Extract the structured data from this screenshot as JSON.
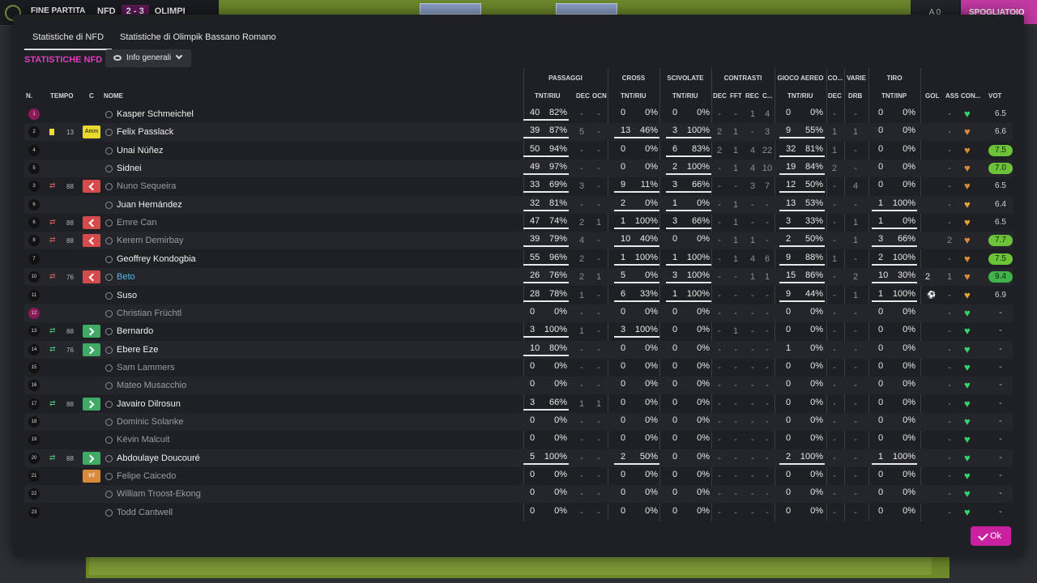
{
  "topbar": {
    "end_match": "FINE PARTITA",
    "home": "NFD",
    "score": "2 - 3",
    "away": "OLIMPI",
    "score_mini": "A 0",
    "locker_button": "SPOGLIATOIO"
  },
  "tabs": [
    {
      "label": "Statistiche di NFD",
      "active": true
    },
    {
      "label": "Statistiche di Olimpik Bassano Romano",
      "active": false
    }
  ],
  "section_title": "STATISTICHE NFD",
  "view_dropdown": {
    "label": "Info generali",
    "icon": "eye-icon"
  },
  "groups": {
    "passaggi": "PASSAGGI",
    "cross": "CROSS",
    "scivolate": "SCIVOLATE",
    "contrasti": "CONTRASTI",
    "gioco_aereo": "GIOCO AEREO",
    "co": "CO...",
    "varie": "VARIE",
    "tiro": "TIRO"
  },
  "columns": {
    "n": "N.",
    "tempo": "TEMPO",
    "c": "C",
    "nome": "NOME",
    "pass_tntriu": "TNT/RIU",
    "pass_dec": "DEC",
    "pass_ocn": "OCN",
    "cross_tntriu": "TNT/RIU",
    "sciv_tntriu": "TNT/RIU",
    "contr_dec": "DEC",
    "contr_fft": "FFT",
    "contr_rec": "REC",
    "contr_c": "C...",
    "aereo_tntriu": "TNT/RIU",
    "co_dec": "DEC",
    "varie_drb": "DRB",
    "tiro_tntinp": "TNT/INP",
    "gol": "GOL",
    "ass": "ASS",
    "con": "CON...",
    "vot": "VOT"
  },
  "players": [
    {
      "n": "1",
      "gk": true,
      "tempo": "",
      "card": "",
      "sub": "",
      "badge": "",
      "name": "Kasper Schmeichel",
      "style": "normal",
      "pass": [
        "40",
        "82%"
      ],
      "pass_ul": true,
      "pdec": "-",
      "pocn": "-",
      "cross": [
        "0",
        "0%"
      ],
      "cross_ul": false,
      "sciv": [
        "0",
        "0%"
      ],
      "sciv_ul": false,
      "cdec": "-",
      "cfft": "-",
      "crec": "1",
      "cc": "4",
      "aereo": [
        "0",
        "0%"
      ],
      "aereo_ul": false,
      "codec": "-",
      "drb": "-",
      "tiro": [
        "0",
        "0%"
      ],
      "tiro_ul": false,
      "gol": "",
      "ass": "-",
      "heart": "green",
      "vot": "6.5",
      "vot_style": "plain"
    },
    {
      "n": "2",
      "gk": false,
      "tempo": "13",
      "card": "yellow",
      "sub": "",
      "badge": "Amm",
      "name": "Felix Passlack",
      "style": "normal",
      "pass": [
        "39",
        "87%"
      ],
      "pass_ul": true,
      "pdec": "5",
      "pocn": "-",
      "cross": [
        "13",
        "46%"
      ],
      "cross_ul": true,
      "sciv": [
        "3",
        "100%"
      ],
      "sciv_ul": true,
      "cdec": "2",
      "cfft": "1",
      "crec": "-",
      "cc": "3",
      "aereo": [
        "9",
        "55%"
      ],
      "aereo_ul": true,
      "codec": "1",
      "drb": "1",
      "tiro": [
        "0",
        "0%"
      ],
      "tiro_ul": false,
      "gol": "",
      "ass": "-",
      "heart": "orange",
      "vot": "6.6",
      "vot_style": "plain"
    },
    {
      "n": "4",
      "gk": false,
      "tempo": "",
      "card": "",
      "sub": "",
      "badge": "",
      "name": "Unai Núñez",
      "style": "normal",
      "pass": [
        "50",
        "94%"
      ],
      "pass_ul": true,
      "pdec": "-",
      "pocn": "-",
      "cross": [
        "0",
        "0%"
      ],
      "cross_ul": false,
      "sciv": [
        "6",
        "83%"
      ],
      "sciv_ul": true,
      "cdec": "2",
      "cfft": "1",
      "crec": "4",
      "cc": "22",
      "aereo": [
        "32",
        "81%"
      ],
      "aereo_ul": true,
      "codec": "1",
      "drb": "-",
      "tiro": [
        "0",
        "0%"
      ],
      "tiro_ul": false,
      "gol": "",
      "ass": "-",
      "heart": "orange",
      "vot": "7.5",
      "vot_style": "green"
    },
    {
      "n": "5",
      "gk": false,
      "tempo": "",
      "card": "",
      "sub": "",
      "badge": "",
      "name": "Sidnei",
      "style": "normal",
      "pass": [
        "49",
        "97%"
      ],
      "pass_ul": true,
      "pdec": "-",
      "pocn": "-",
      "cross": [
        "0",
        "0%"
      ],
      "cross_ul": false,
      "sciv": [
        "2",
        "100%"
      ],
      "sciv_ul": true,
      "cdec": "-",
      "cfft": "1",
      "crec": "4",
      "cc": "10",
      "aereo": [
        "19",
        "84%"
      ],
      "aereo_ul": true,
      "codec": "2",
      "drb": "-",
      "tiro": [
        "0",
        "0%"
      ],
      "tiro_ul": false,
      "gol": "",
      "ass": "-",
      "heart": "orange",
      "vot": "7.0",
      "vot_style": "green"
    },
    {
      "n": "3",
      "gk": false,
      "tempo": "88",
      "card": "",
      "sub": "out",
      "badge": "out",
      "name": "Nuno Sequeira",
      "style": "dim",
      "pass": [
        "33",
        "69%"
      ],
      "pass_ul": true,
      "pdec": "3",
      "pocn": "-",
      "cross": [
        "9",
        "11%"
      ],
      "cross_ul": true,
      "sciv": [
        "3",
        "66%"
      ],
      "sciv_ul": true,
      "cdec": "-",
      "cfft": "-",
      "crec": "3",
      "cc": "7",
      "aereo": [
        "12",
        "50%"
      ],
      "aereo_ul": true,
      "codec": "-",
      "drb": "4",
      "tiro": [
        "0",
        "0%"
      ],
      "tiro_ul": false,
      "gol": "",
      "ass": "-",
      "heart": "orange",
      "vot": "6.5",
      "vot_style": "plain"
    },
    {
      "n": "6",
      "gk": false,
      "tempo": "",
      "card": "",
      "sub": "",
      "badge": "",
      "name": "Juan Hernández",
      "style": "normal",
      "pass": [
        "32",
        "81%"
      ],
      "pass_ul": true,
      "pdec": "-",
      "pocn": "-",
      "cross": [
        "2",
        "0%"
      ],
      "cross_ul": true,
      "sciv": [
        "1",
        "0%"
      ],
      "sciv_ul": true,
      "cdec": "-",
      "cfft": "1",
      "crec": "-",
      "cc": "-",
      "aereo": [
        "13",
        "53%"
      ],
      "aereo_ul": true,
      "codec": "-",
      "drb": "-",
      "tiro": [
        "1",
        "100%"
      ],
      "tiro_ul": true,
      "gol": "",
      "ass": "-",
      "heart": "amber",
      "vot": "6.4",
      "vot_style": "plain"
    },
    {
      "n": "6",
      "gk": false,
      "tempo": "88",
      "card": "",
      "sub": "out",
      "badge": "out",
      "name": "Emre Can",
      "style": "dim",
      "pass": [
        "47",
        "74%"
      ],
      "pass_ul": true,
      "pdec": "2",
      "pocn": "1",
      "cross": [
        "1",
        "100%"
      ],
      "cross_ul": true,
      "sciv": [
        "3",
        "66%"
      ],
      "sciv_ul": true,
      "cdec": "-",
      "cfft": "1",
      "crec": "-",
      "cc": "-",
      "aereo": [
        "3",
        "33%"
      ],
      "aereo_ul": true,
      "codec": "-",
      "drb": "1",
      "tiro": [
        "1",
        "0%"
      ],
      "tiro_ul": true,
      "gol": "",
      "ass": "-",
      "heart": "amber",
      "vot": "6.5",
      "vot_style": "plain"
    },
    {
      "n": "8",
      "gk": false,
      "tempo": "88",
      "card": "",
      "sub": "out",
      "badge": "out",
      "name": "Kerem Demirbay",
      "style": "dim",
      "pass": [
        "39",
        "79%"
      ],
      "pass_ul": true,
      "pdec": "4",
      "pocn": "-",
      "cross": [
        "10",
        "40%"
      ],
      "cross_ul": true,
      "sciv": [
        "0",
        "0%"
      ],
      "sciv_ul": false,
      "cdec": "-",
      "cfft": "1",
      "crec": "1",
      "cc": "-",
      "aereo": [
        "2",
        "50%"
      ],
      "aereo_ul": true,
      "codec": "-",
      "drb": "1",
      "tiro": [
        "3",
        "66%"
      ],
      "tiro_ul": true,
      "gol": "",
      "ass": "2",
      "heart": "orange",
      "vot": "7.7",
      "vot_style": "green"
    },
    {
      "n": "7",
      "gk": false,
      "tempo": "",
      "card": "",
      "sub": "",
      "badge": "",
      "name": "Geoffrey Kondogbia",
      "style": "normal",
      "pass": [
        "55",
        "96%"
      ],
      "pass_ul": true,
      "pdec": "2",
      "pocn": "-",
      "cross": [
        "1",
        "100%"
      ],
      "cross_ul": true,
      "sciv": [
        "1",
        "100%"
      ],
      "sciv_ul": true,
      "cdec": "-",
      "cfft": "1",
      "crec": "4",
      "cc": "6",
      "aereo": [
        "9",
        "88%"
      ],
      "aereo_ul": true,
      "codec": "1",
      "drb": "-",
      "tiro": [
        "2",
        "100%"
      ],
      "tiro_ul": true,
      "gol": "",
      "ass": "-",
      "heart": "orange",
      "vot": "7.5",
      "vot_style": "green"
    },
    {
      "n": "10",
      "gk": false,
      "tempo": "76",
      "card": "",
      "sub": "out",
      "badge": "out",
      "name": "Beto",
      "style": "hl",
      "pass": [
        "26",
        "76%"
      ],
      "pass_ul": true,
      "pdec": "2",
      "pocn": "1",
      "cross": [
        "5",
        "0%"
      ],
      "cross_ul": true,
      "sciv": [
        "3",
        "100%"
      ],
      "sciv_ul": true,
      "cdec": "-",
      "cfft": "-",
      "crec": "1",
      "cc": "1",
      "aereo": [
        "15",
        "86%"
      ],
      "aereo_ul": true,
      "codec": "-",
      "drb": "2",
      "tiro": [
        "10",
        "30%"
      ],
      "tiro_ul": true,
      "gol": "2",
      "ass": "1",
      "heart": "orange",
      "vot": "9.4",
      "vot_style": "dgreen"
    },
    {
      "n": "11",
      "gk": false,
      "tempo": "",
      "card": "",
      "sub": "",
      "badge": "",
      "name": "Suso",
      "style": "normal",
      "pass": [
        "28",
        "78%"
      ],
      "pass_ul": true,
      "pdec": "1",
      "pocn": "-",
      "cross": [
        "6",
        "33%"
      ],
      "cross_ul": true,
      "sciv": [
        "1",
        "100%"
      ],
      "sciv_ul": true,
      "cdec": "-",
      "cfft": "-",
      "crec": "-",
      "cc": "-",
      "aereo": [
        "9",
        "44%"
      ],
      "aereo_ul": true,
      "codec": "-",
      "drb": "1",
      "tiro": [
        "1",
        "100%"
      ],
      "tiro_ul": true,
      "gol": "ball",
      "ass": "-",
      "heart": "amber",
      "vot": "6.9",
      "vot_style": "plain"
    },
    {
      "n": "12",
      "gk": true,
      "tempo": "",
      "card": "",
      "sub": "",
      "badge": "",
      "name": "Christian Früchtl",
      "style": "dim",
      "pass": [
        "0",
        "0%"
      ],
      "pass_ul": false,
      "pdec": "-",
      "pocn": "-",
      "cross": [
        "0",
        "0%"
      ],
      "cross_ul": false,
      "sciv": [
        "0",
        "0%"
      ],
      "sciv_ul": false,
      "cdec": "-",
      "cfft": "-",
      "crec": "-",
      "cc": "-",
      "aereo": [
        "0",
        "0%"
      ],
      "aereo_ul": false,
      "codec": "-",
      "drb": "-",
      "tiro": [
        "0",
        "0%"
      ],
      "tiro_ul": false,
      "gol": "",
      "ass": "-",
      "heart": "green",
      "vot": "-",
      "vot_style": "plain"
    },
    {
      "n": "13",
      "gk": false,
      "tempo": "88",
      "card": "",
      "sub": "in",
      "badge": "in",
      "name": "Bernardo",
      "style": "normal",
      "pass": [
        "3",
        "100%"
      ],
      "pass_ul": true,
      "pdec": "1",
      "pocn": "-",
      "cross": [
        "3",
        "100%"
      ],
      "cross_ul": true,
      "sciv": [
        "0",
        "0%"
      ],
      "sciv_ul": false,
      "cdec": "-",
      "cfft": "1",
      "crec": "-",
      "cc": "-",
      "aereo": [
        "0",
        "0%"
      ],
      "aereo_ul": false,
      "codec": "-",
      "drb": "-",
      "tiro": [
        "0",
        "0%"
      ],
      "tiro_ul": false,
      "gol": "",
      "ass": "-",
      "heart": "green",
      "vot": "-",
      "vot_style": "plain"
    },
    {
      "n": "14",
      "gk": false,
      "tempo": "76",
      "card": "",
      "sub": "in",
      "badge": "in",
      "name": "Ebere Eze",
      "style": "normal",
      "pass": [
        "10",
        "80%"
      ],
      "pass_ul": true,
      "pdec": "-",
      "pocn": "-",
      "cross": [
        "0",
        "0%"
      ],
      "cross_ul": false,
      "sciv": [
        "0",
        "0%"
      ],
      "sciv_ul": false,
      "cdec": "-",
      "cfft": "-",
      "crec": "-",
      "cc": "-",
      "aereo": [
        "1",
        "0%"
      ],
      "aereo_ul": false,
      "codec": "-",
      "drb": "-",
      "tiro": [
        "0",
        "0%"
      ],
      "tiro_ul": false,
      "gol": "",
      "ass": "-",
      "heart": "green",
      "vot": "-",
      "vot_style": "plain"
    },
    {
      "n": "15",
      "gk": false,
      "tempo": "",
      "card": "",
      "sub": "",
      "badge": "",
      "name": "Sam Lammers",
      "style": "dim",
      "pass": [
        "0",
        "0%"
      ],
      "pass_ul": false,
      "pdec": "-",
      "pocn": "-",
      "cross": [
        "0",
        "0%"
      ],
      "cross_ul": false,
      "sciv": [
        "0",
        "0%"
      ],
      "sciv_ul": false,
      "cdec": "-",
      "cfft": "-",
      "crec": "-",
      "cc": "-",
      "aereo": [
        "0",
        "0%"
      ],
      "aereo_ul": false,
      "codec": "-",
      "drb": "-",
      "tiro": [
        "0",
        "0%"
      ],
      "tiro_ul": false,
      "gol": "",
      "ass": "-",
      "heart": "green",
      "vot": "-",
      "vot_style": "plain"
    },
    {
      "n": "16",
      "gk": false,
      "tempo": "",
      "card": "",
      "sub": "",
      "badge": "",
      "name": "Mateo Musacchio",
      "style": "dim",
      "pass": [
        "0",
        "0%"
      ],
      "pass_ul": false,
      "pdec": "-",
      "pocn": "-",
      "cross": [
        "0",
        "0%"
      ],
      "cross_ul": false,
      "sciv": [
        "0",
        "0%"
      ],
      "sciv_ul": false,
      "cdec": "-",
      "cfft": "-",
      "crec": "-",
      "cc": "-",
      "aereo": [
        "0",
        "0%"
      ],
      "aereo_ul": false,
      "codec": "-",
      "drb": "-",
      "tiro": [
        "0",
        "0%"
      ],
      "tiro_ul": false,
      "gol": "",
      "ass": "-",
      "heart": "green",
      "vot": "-",
      "vot_style": "plain"
    },
    {
      "n": "17",
      "gk": false,
      "tempo": "88",
      "card": "",
      "sub": "in",
      "badge": "in",
      "name": "Javairo Dilrosun",
      "style": "normal",
      "pass": [
        "3",
        "66%"
      ],
      "pass_ul": true,
      "pdec": "1",
      "pocn": "1",
      "cross": [
        "0",
        "0%"
      ],
      "cross_ul": false,
      "sciv": [
        "0",
        "0%"
      ],
      "sciv_ul": false,
      "cdec": "-",
      "cfft": "-",
      "crec": "-",
      "cc": "-",
      "aereo": [
        "0",
        "0%"
      ],
      "aereo_ul": false,
      "codec": "-",
      "drb": "-",
      "tiro": [
        "0",
        "0%"
      ],
      "tiro_ul": false,
      "gol": "",
      "ass": "-",
      "heart": "green",
      "vot": "-",
      "vot_style": "plain"
    },
    {
      "n": "18",
      "gk": false,
      "tempo": "",
      "card": "",
      "sub": "",
      "badge": "",
      "name": "Dominic Solanke",
      "style": "dim",
      "pass": [
        "0",
        "0%"
      ],
      "pass_ul": false,
      "pdec": "-",
      "pocn": "-",
      "cross": [
        "0",
        "0%"
      ],
      "cross_ul": false,
      "sciv": [
        "0",
        "0%"
      ],
      "sciv_ul": false,
      "cdec": "-",
      "cfft": "-",
      "crec": "-",
      "cc": "-",
      "aereo": [
        "0",
        "0%"
      ],
      "aereo_ul": false,
      "codec": "-",
      "drb": "-",
      "tiro": [
        "0",
        "0%"
      ],
      "tiro_ul": false,
      "gol": "",
      "ass": "-",
      "heart": "green",
      "vot": "-",
      "vot_style": "plain"
    },
    {
      "n": "19",
      "gk": false,
      "tempo": "",
      "card": "",
      "sub": "",
      "badge": "",
      "name": "Kévin Malcuit",
      "style": "dim",
      "pass": [
        "0",
        "0%"
      ],
      "pass_ul": false,
      "pdec": "-",
      "pocn": "-",
      "cross": [
        "0",
        "0%"
      ],
      "cross_ul": false,
      "sciv": [
        "0",
        "0%"
      ],
      "sciv_ul": false,
      "cdec": "-",
      "cfft": "-",
      "crec": "-",
      "cc": "-",
      "aereo": [
        "0",
        "0%"
      ],
      "aereo_ul": false,
      "codec": "-",
      "drb": "-",
      "tiro": [
        "0",
        "0%"
      ],
      "tiro_ul": false,
      "gol": "",
      "ass": "-",
      "heart": "green",
      "vot": "-",
      "vot_style": "plain"
    },
    {
      "n": "20",
      "gk": false,
      "tempo": "88",
      "card": "",
      "sub": "in",
      "badge": "in",
      "name": "Abdoulaye Doucouré",
      "style": "normal",
      "pass": [
        "5",
        "100%"
      ],
      "pass_ul": true,
      "pdec": "-",
      "pocn": "-",
      "cross": [
        "2",
        "50%"
      ],
      "cross_ul": true,
      "sciv": [
        "0",
        "0%"
      ],
      "sciv_ul": false,
      "cdec": "-",
      "cfft": "-",
      "crec": "-",
      "cc": "-",
      "aereo": [
        "2",
        "100%"
      ],
      "aereo_ul": true,
      "codec": "-",
      "drb": "-",
      "tiro": [
        "1",
        "100%"
      ],
      "tiro_ul": true,
      "gol": "",
      "ass": "-",
      "heart": "green",
      "vot": "-",
      "vot_style": "plain"
    },
    {
      "n": "21",
      "gk": false,
      "tempo": "",
      "card": "",
      "sub": "",
      "badge": "Inf",
      "name": "Felipe Caicedo",
      "style": "dim",
      "pass": [
        "0",
        "0%"
      ],
      "pass_ul": false,
      "pdec": "-",
      "pocn": "-",
      "cross": [
        "0",
        "0%"
      ],
      "cross_ul": false,
      "sciv": [
        "0",
        "0%"
      ],
      "sciv_ul": false,
      "cdec": "-",
      "cfft": "-",
      "crec": "-",
      "cc": "-",
      "aereo": [
        "0",
        "0%"
      ],
      "aereo_ul": false,
      "codec": "-",
      "drb": "-",
      "tiro": [
        "0",
        "0%"
      ],
      "tiro_ul": false,
      "gol": "",
      "ass": "-",
      "heart": "green",
      "vot": "-",
      "vot_style": "plain"
    },
    {
      "n": "22",
      "gk": false,
      "tempo": "",
      "card": "",
      "sub": "",
      "badge": "",
      "name": "William Troost-Ekong",
      "style": "dim",
      "pass": [
        "0",
        "0%"
      ],
      "pass_ul": false,
      "pdec": "-",
      "pocn": "-",
      "cross": [
        "0",
        "0%"
      ],
      "cross_ul": false,
      "sciv": [
        "0",
        "0%"
      ],
      "sciv_ul": false,
      "cdec": "-",
      "cfft": "-",
      "crec": "-",
      "cc": "-",
      "aereo": [
        "0",
        "0%"
      ],
      "aereo_ul": false,
      "codec": "-",
      "drb": "-",
      "tiro": [
        "0",
        "0%"
      ],
      "tiro_ul": false,
      "gol": "",
      "ass": "-",
      "heart": "green",
      "vot": "-",
      "vot_style": "plain"
    },
    {
      "n": "23",
      "gk": false,
      "tempo": "",
      "card": "",
      "sub": "",
      "badge": "",
      "name": "Todd Cantwell",
      "style": "dim",
      "pass": [
        "0",
        "0%"
      ],
      "pass_ul": false,
      "pdec": "-",
      "pocn": "-",
      "cross": [
        "0",
        "0%"
      ],
      "cross_ul": false,
      "sciv": [
        "0",
        "0%"
      ],
      "sciv_ul": false,
      "cdec": "-",
      "cfft": "-",
      "crec": "-",
      "cc": "-",
      "aereo": [
        "0",
        "0%"
      ],
      "aereo_ul": false,
      "codec": "-",
      "drb": "-",
      "tiro": [
        "0",
        "0%"
      ],
      "tiro_ul": false,
      "gol": "",
      "ass": "-",
      "heart": "green",
      "vot": "-",
      "vot_style": "plain"
    }
  ],
  "ok_button": "Ok"
}
